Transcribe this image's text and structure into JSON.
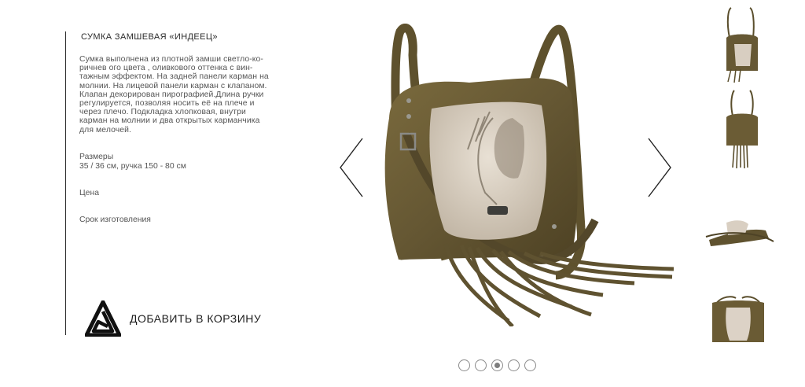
{
  "product": {
    "title": "СУМКА ЗАМШЕВАЯ «ИНДЕЕЦ»",
    "description": "Сумка выполнена из плотной замши светло-ко-\nричнев   ого цвета , оливкового оттенка с вин-\nтажным эффектом. На задней панели карман на\nмолнии. На лицевой панели карман с клапаном.\nКлапан декорирован пирографией.Длина ручки\nрегулируется, позволяя носить её на плече и\nчерез плечо. Подкладка хлопковая, внутри\nкарман на молнии и два открытых карманчика\nдля мелочей.",
    "sizes_label": "Размеры",
    "sizes_value": "35 / 36 см, ручка 150 - 80 см",
    "price_label": "Цена",
    "term_label": "Срок изготовления"
  },
  "cart": {
    "label": "ДОБАВИТЬ В КОРЗИНУ",
    "logo_icon": "triangle-spiral-logo-icon"
  },
  "gallery": {
    "prev_icon": "chevron-left-icon",
    "next_icon": "chevron-right-icon",
    "slide_count": 5,
    "active_slide": 3,
    "thumbnail_count": 4
  },
  "colors": {
    "suede": "#6b5c33",
    "suede_dark": "#4e4224",
    "flap": "#dcd2c6",
    "text": "#555555"
  }
}
